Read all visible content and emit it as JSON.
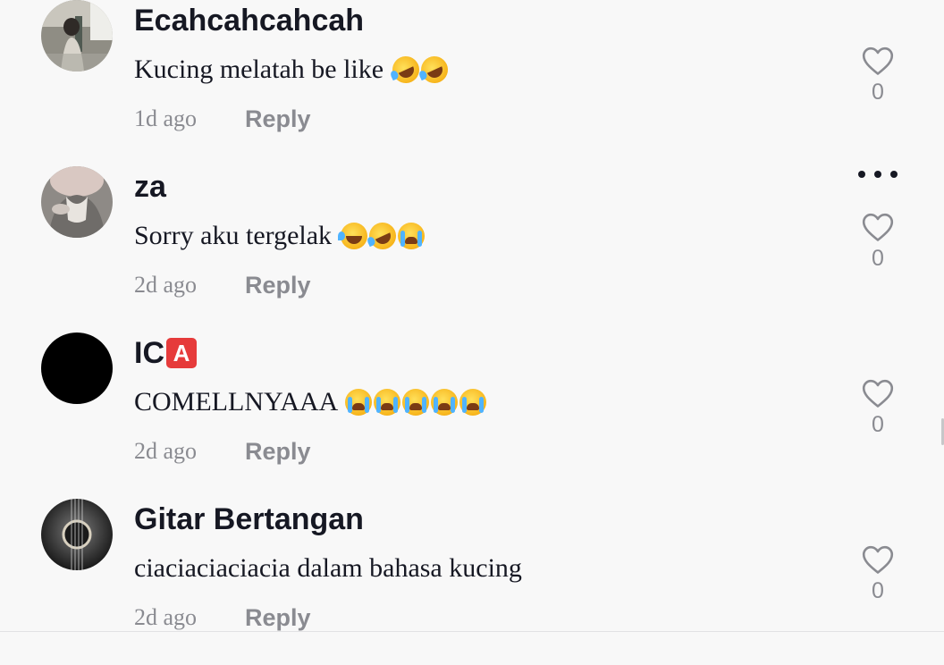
{
  "comments": [
    {
      "username": "Ecahcahcahcah",
      "text": "Kucing melatah be like",
      "emojis": [
        "rofl-emoji",
        "rofl-emoji"
      ],
      "time": "1d ago",
      "reply_label": "Reply",
      "like_count": "0",
      "avatar": "photo-avatar"
    },
    {
      "username": "za",
      "text": "Sorry aku tergelak",
      "emojis": [
        "joy-emoji",
        "rofl-emoji",
        "crying-emoji"
      ],
      "time": "2d ago",
      "reply_label": "Reply",
      "like_count": "0",
      "avatar": "photo-avatar"
    },
    {
      "username": "IC",
      "username_badge": "A",
      "text": "COMELLNYAAA",
      "emojis": [
        "crying-emoji",
        "crying-emoji",
        "crying-emoji",
        "crying-emoji",
        "crying-emoji"
      ],
      "time": "2d ago",
      "reply_label": "Reply",
      "like_count": "0",
      "avatar": "black-avatar"
    },
    {
      "username": "Gitar Bertangan",
      "text": "ciaciaciaciacia dalam bahasa kucing",
      "emojis": [],
      "time": "2d ago",
      "reply_label": "Reply",
      "like_count": "0",
      "avatar": "guitar-avatar"
    }
  ],
  "icons": {
    "like": "heart-outline-icon",
    "more": "more-dots-icon"
  },
  "colors": {
    "background": "#f8f8f8",
    "primary_text": "#161823",
    "secondary_text": "#8a8b91",
    "badge": "#e63b3b"
  }
}
